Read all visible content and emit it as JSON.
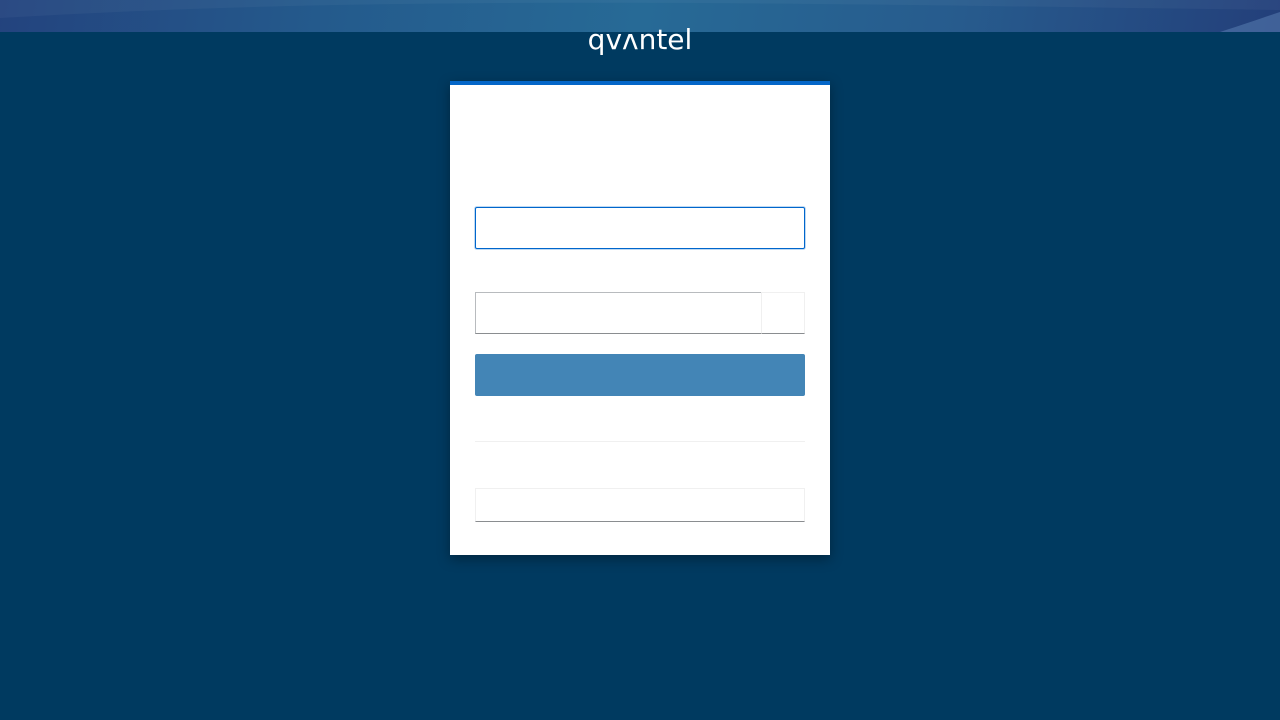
{
  "branding": {
    "logo_text": "qvʌntel"
  },
  "login_form": {
    "username": {
      "value": "",
      "placeholder": ""
    },
    "password": {
      "value": "",
      "placeholder": "",
      "toggle_label": ""
    },
    "submit_label": "",
    "provider_label": ""
  },
  "colors": {
    "background": "#003a60",
    "accent": "#0466c8",
    "button": "#4385b6"
  }
}
